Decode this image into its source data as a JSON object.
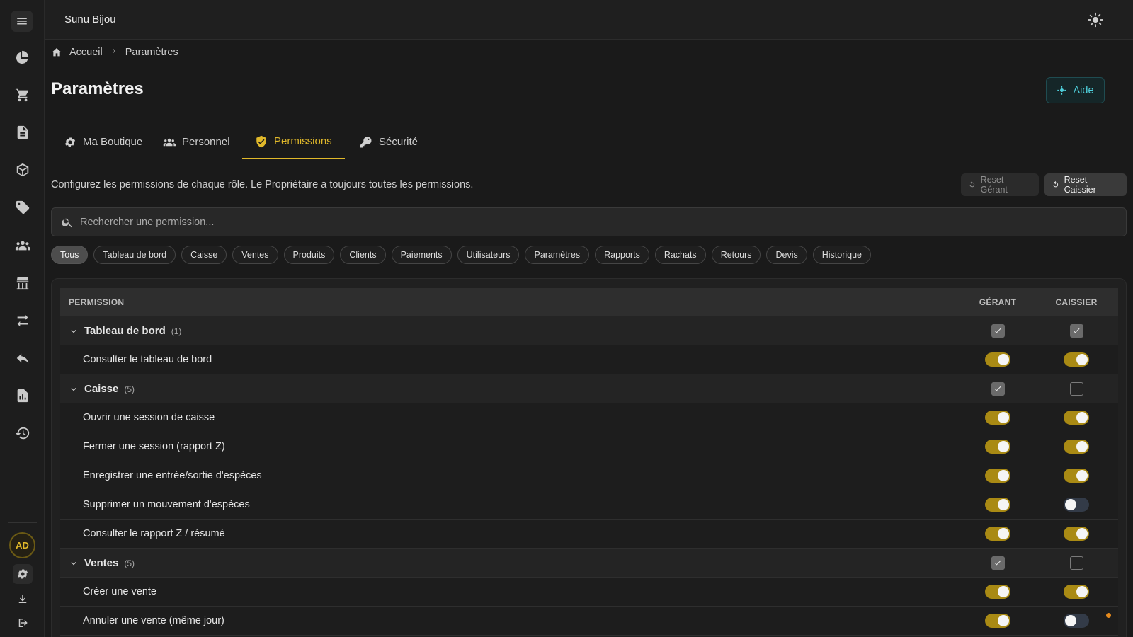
{
  "app": {
    "title": "Sunu Bijou"
  },
  "user": {
    "initials": "AD"
  },
  "breadcrumb": {
    "home": "Accueil",
    "current": "Paramètres"
  },
  "page": {
    "title": "Paramètres",
    "help_label": "Aide"
  },
  "tabs": [
    {
      "label": "Ma Boutique",
      "icon": "gear-icon"
    },
    {
      "label": "Personnel",
      "icon": "people-icon"
    },
    {
      "label": "Permissions",
      "icon": "shield-icon",
      "active": true
    },
    {
      "label": "Sécurité",
      "icon": "key-icon"
    }
  ],
  "permissions": {
    "description": "Configurez les permissions de chaque rôle. Le Propriétaire a toujours toutes les permissions.",
    "reset_gerant": "Reset Gérant",
    "reset_caissier": "Reset Caissier",
    "search_placeholder": "Rechercher une permission...",
    "filters": [
      "Tous",
      "Tableau de bord",
      "Caisse",
      "Ventes",
      "Produits",
      "Clients",
      "Paiements",
      "Utilisateurs",
      "Paramètres",
      "Rapports",
      "Rachats",
      "Retours",
      "Devis",
      "Historique"
    ],
    "active_filter": "Tous",
    "columns": {
      "permission": "PERMISSION",
      "gerant": "GÉRANT",
      "caissier": "CAISSIER"
    },
    "groups": [
      {
        "name": "Tableau de bord",
        "count": "(1)",
        "gerant": "checked",
        "caissier": "checked",
        "items": [
          {
            "label": "Consulter le tableau de bord",
            "gerant": true,
            "caissier": true
          }
        ]
      },
      {
        "name": "Caisse",
        "count": "(5)",
        "gerant": "checked",
        "caissier": "partial",
        "items": [
          {
            "label": "Ouvrir une session de caisse",
            "gerant": true,
            "caissier": true
          },
          {
            "label": "Fermer une session (rapport Z)",
            "gerant": true,
            "caissier": true
          },
          {
            "label": "Enregistrer une entrée/sortie d'espèces",
            "gerant": true,
            "caissier": true
          },
          {
            "label": "Supprimer un mouvement d'espèces",
            "gerant": true,
            "caissier": false
          },
          {
            "label": "Consulter le rapport Z / résumé",
            "gerant": true,
            "caissier": true
          }
        ]
      },
      {
        "name": "Ventes",
        "count": "(5)",
        "gerant": "checked",
        "caissier": "partial",
        "items": [
          {
            "label": "Créer une vente",
            "gerant": true,
            "caissier": true
          },
          {
            "label": "Annuler une vente (même jour)",
            "gerant": true,
            "caissier": false
          }
        ]
      }
    ]
  },
  "colors": {
    "accent": "#e0b82a",
    "toggle_on": "#a98a14",
    "toggle_off": "#333b48",
    "help": "#4fd0dc",
    "notification": "#e68a1c"
  }
}
